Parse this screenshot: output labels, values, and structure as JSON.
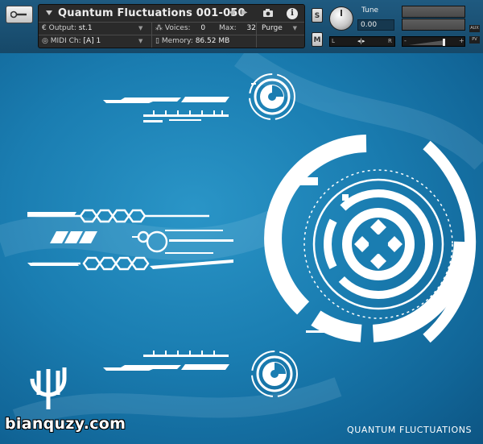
{
  "instrument": {
    "title": "Quantum Fluctuations 001-050",
    "output_label": "Output:",
    "output_value": "st.1",
    "voices_label": "Voices:",
    "voices_value": "0",
    "max_label": "Max:",
    "max_value": "32",
    "purge_label": "Purge",
    "midi_label": "MIDI Ch:",
    "midi_value": "[A]  1",
    "memory_label": "Memory:",
    "memory_value": "86.52 MB"
  },
  "controls": {
    "solo_label": "S",
    "mute_label": "M",
    "tune_label": "Tune",
    "tune_value": "0.00",
    "pan_left": "L",
    "pan_right": "R",
    "vol_minus": "-",
    "vol_plus": "+",
    "aux_label": "AUX",
    "pv_label": "PV"
  },
  "footer": {
    "watermark": "bianquzy.com",
    "product_name": "QUANTUM FLUCTUATIONS"
  },
  "icons": [
    "wrench-icon",
    "collapse-arrow-icon",
    "prev-arrow-icon",
    "next-arrow-icon",
    "camera-icon",
    "info-icon",
    "output-icon",
    "midi-icon",
    "voices-icon",
    "memory-icon"
  ],
  "colors": {
    "background": "#1a7db1",
    "header": "#1f5a80",
    "panel": "#2a2a2a",
    "graphics": "#ffffff"
  }
}
